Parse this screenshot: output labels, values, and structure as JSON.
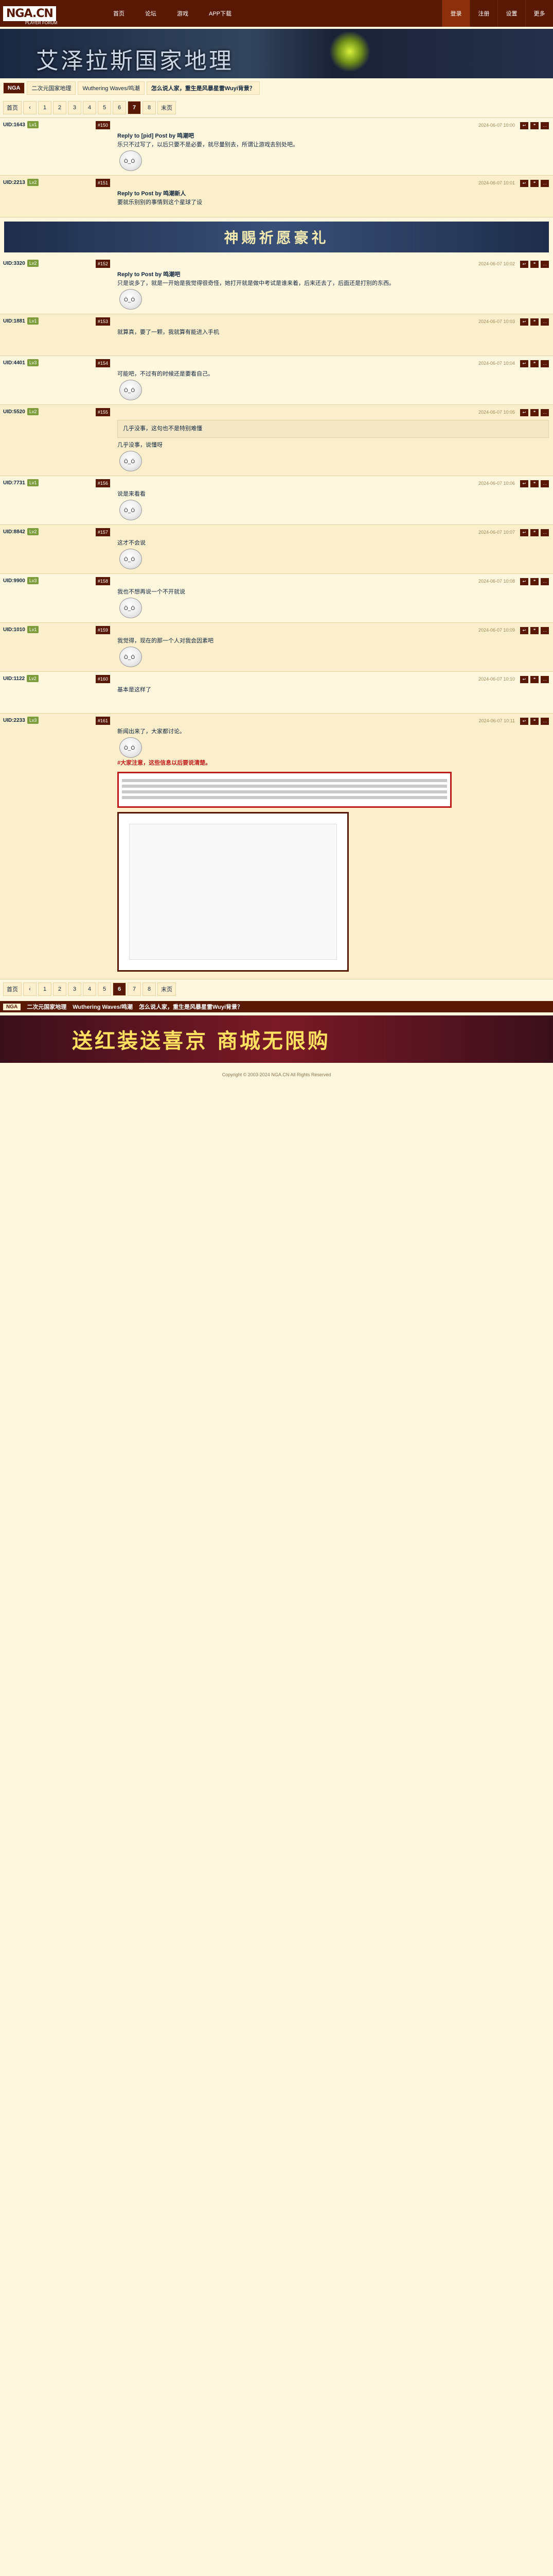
{
  "site": {
    "logo": "NGA.CN",
    "logo_sub": "PLAYER FORUM"
  },
  "topnav": [
    "首页",
    "论坛",
    "游戏",
    "APP下载"
  ],
  "topright": [
    "登录",
    "注册",
    "设置",
    "更多"
  ],
  "banner": {
    "title": "艾泽拉斯国家地理"
  },
  "breadcrumb": [
    "NGA",
    "二次元国家地理",
    "Wuthering Waves/鸣潮",
    "怎么说人家，重生是风暴星雷Wuyi背景？"
  ],
  "pager_top": [
    "首页",
    "‹",
    "1",
    "2",
    "3",
    "4",
    "5",
    "6",
    "7",
    "8",
    "末页"
  ],
  "pager_top_current": "7",
  "pager_bottom": [
    "首页",
    "‹",
    "1",
    "2",
    "3",
    "4",
    "5",
    "6",
    "7",
    "8",
    "末页"
  ],
  "pager_bottom_current": "6",
  "posts": [
    {
      "uid": "UID:1643",
      "badge": "Lv1",
      "floor": "#150",
      "time": "2024-06-07 10:00",
      "reply": "Reply to [pid] Post by 鸣潮吧",
      "body": "乐只不过写了，以后只要不是必要，就尽量别去，所谓让游戏去别处吧。",
      "quote": "",
      "meme": true
    },
    {
      "uid": "UID:2213",
      "badge": "Lv2",
      "floor": "#151",
      "time": "2024-06-07 10:01",
      "reply": "Reply to Post by 鸣潮新人",
      "body": "要就乐别别的事情到这个星球了设",
      "quote": "",
      "meme": false
    },
    {
      "uid": "UID:3320",
      "badge": "Lv2",
      "floor": "#152",
      "time": "2024-06-07 10:02",
      "reply": "Reply to Post by 鸣潮吧",
      "body": "只是说多了，就是一开始是我觉得很奇怪，她打开就是做中考试是谁来着，后来还去了，后面还是打别的东西。",
      "quote": "",
      "meme": true
    },
    {
      "uid": "UID:1881",
      "badge": "Lv1",
      "floor": "#153",
      "time": "2024-06-07 10:03",
      "reply": "",
      "body": "就算真，要了一颗，我就算有能进入手机",
      "quote": "",
      "meme": false
    },
    {
      "uid": "UID:4401",
      "badge": "Lv3",
      "floor": "#154",
      "time": "2024-06-07 10:04",
      "reply": "",
      "body": "可能吧，不过有的时候还是要看自己。",
      "quote": "",
      "meme": true
    },
    {
      "uid": "UID:5520",
      "badge": "Lv2",
      "floor": "#155",
      "time": "2024-06-07 10:05",
      "reply": "",
      "body": "几乎没事，说懂呀",
      "quote": "几乎没事，这句也不是特别难懂",
      "meme": true
    },
    {
      "uid": "UID:7731",
      "badge": "Lv1",
      "floor": "#156",
      "time": "2024-06-07 10:06",
      "reply": "",
      "body": "说是来看看",
      "quote": "",
      "meme": true
    },
    {
      "uid": "UID:8842",
      "badge": "Lv2",
      "floor": "#157",
      "time": "2024-06-07 10:07",
      "reply": "",
      "body": "这才不会说",
      "quote": "",
      "meme": true
    },
    {
      "uid": "UID:9900",
      "badge": "Lv3",
      "floor": "#158",
      "time": "2024-06-07 10:08",
      "reply": "",
      "body": "我也不想再说一个不开就说",
      "quote": "",
      "meme": true
    },
    {
      "uid": "UID:1010",
      "badge": "Lv1",
      "floor": "#159",
      "time": "2024-06-07 10:09",
      "reply": "",
      "body": "我觉得，现在的那一个人对我会因素吧",
      "quote": "",
      "meme": true
    },
    {
      "uid": "UID:1122",
      "badge": "Lv2",
      "floor": "#160",
      "time": "2024-06-07 10:10",
      "reply": "",
      "body": "基本是这样了",
      "quote": "",
      "meme": false
    },
    {
      "uid": "UID:2233",
      "badge": "Lv3",
      "floor": "#161",
      "time": "2024-06-07 10:11",
      "reply": "",
      "body": "新闻出来了，大家都讨论。",
      "quote": "",
      "meme": true,
      "red": "#大家注意，这些信息以后要说清楚。",
      "shot": true
    }
  ],
  "ad1": "神赐祈愿豪礼",
  "footbar": {
    "badge": "NGA",
    "items": [
      "二次元国家地理",
      "Wuthering Waves/鸣潮",
      "怎么说人家，重生是风暴星雷Wuyi背景？"
    ]
  },
  "bottom_ad": "送红装送喜京 商城无限购",
  "copyright": "Copyright © 2003-2024 NGA.CN All Rights Reserved"
}
